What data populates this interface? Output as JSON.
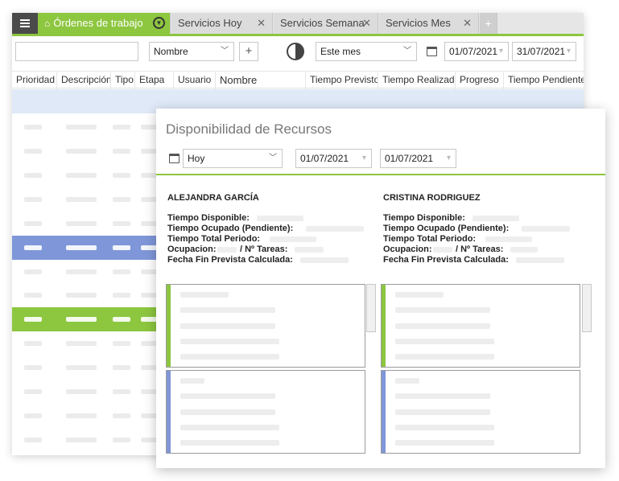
{
  "tabs": [
    {
      "label": "Órdenes de trabajo",
      "active": true
    },
    {
      "label": "Servicios Hoy",
      "active": false
    },
    {
      "label": "Servicios Semana",
      "active": false
    },
    {
      "label": "Servicios Mes",
      "active": false
    }
  ],
  "tab_add_label": "+",
  "toolbar": {
    "search_value": "",
    "field_select": "Nombre",
    "add_label": "+",
    "period_select": "Este mes",
    "date_from": "01/07/2021",
    "date_to": "31/07/2021"
  },
  "grid": {
    "columns": [
      "Prioridad",
      "Descripción",
      "Tipo",
      "Etapa",
      "Usuario",
      "Nombre",
      "Tiempo Previsto",
      "Tiempo Realizado",
      "Progreso",
      "Tiempo Pendiente"
    ]
  },
  "modal": {
    "title": "Disponibilidad de Recursos",
    "period_select": "Hoy",
    "date_from": "01/07/2021",
    "date_to": "01/07/2021",
    "resources": [
      {
        "name": "ALEJANDRA GARCÍA",
        "labels": [
          "Tiempo Disponible:",
          "Tiempo Ocupado (Pendiente):",
          "Tiempo Total Periodo:",
          "Ocupacion:",
          "/ Nº Tareas:",
          "Fecha Fin Prevista Calculada:"
        ]
      },
      {
        "name": "CRISTINA RODRIGUEZ",
        "labels": [
          "Tiempo Disponible:",
          "Tiempo Ocupado (Pendiente):",
          "Tiempo Total Periodo:",
          "Ocupacion:",
          "/ Nº Tareas:",
          "Fecha Fin Prevista Calculada:"
        ]
      }
    ]
  },
  "colors": {
    "accent_green": "#8dc63f",
    "row_blue": "#7f97d9",
    "panel_blue": "#8096d8"
  }
}
